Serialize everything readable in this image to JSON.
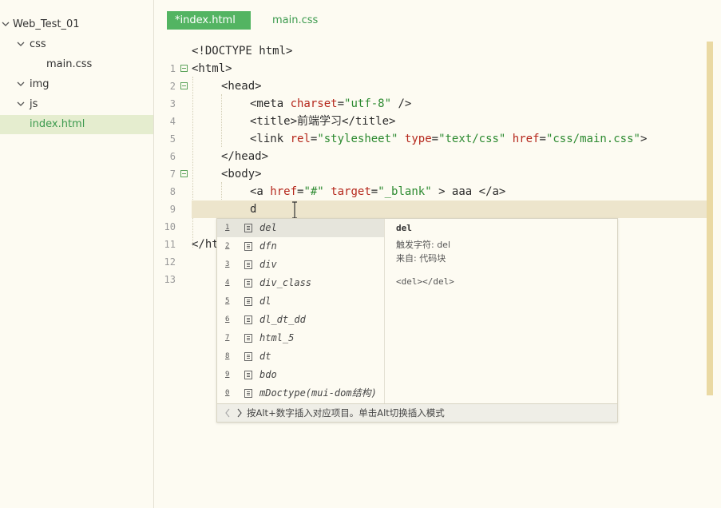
{
  "sidebar": {
    "project": "Web_Test_01",
    "items": [
      {
        "label": "css"
      },
      {
        "label": "main.css"
      },
      {
        "label": "img"
      },
      {
        "label": "js"
      },
      {
        "label": "index.html"
      }
    ]
  },
  "tabs": [
    {
      "label": "*index.html"
    },
    {
      "label": "main.css"
    }
  ],
  "lines": [
    {
      "no": "1"
    },
    {
      "no": "2"
    },
    {
      "no": "3"
    },
    {
      "no": "4"
    },
    {
      "no": "5"
    },
    {
      "no": "6"
    },
    {
      "no": "7"
    },
    {
      "no": "8"
    },
    {
      "no": "9"
    },
    {
      "no": "10"
    },
    {
      "no": "11"
    },
    {
      "no": "12"
    },
    {
      "no": "13"
    }
  ],
  "code": {
    "l1": "<!DOCTYPE html>",
    "l2": "<html>",
    "l3": "<head>",
    "l4a": "<meta ",
    "l4b": "charset",
    "l4c": "=",
    "l4d": "\"utf-8\"",
    "l4e": " />",
    "l5a": "<title>",
    "l5b": "前端学习",
    "l5c": "</title>",
    "l6a": "<link ",
    "l6b": "rel",
    "l6c": "=",
    "l6d": "\"stylesheet\"",
    "l6e": " ",
    "l6f": "type",
    "l6g": "=",
    "l6h": "\"text/css\"",
    "l6i": " ",
    "l6j": "href",
    "l6k": "=",
    "l6l": "\"css/main.css\"",
    "l6m": ">",
    "l7": "</head>",
    "l8": "<body>",
    "l9a": "<a ",
    "l9b": "href",
    "l9c": "=",
    "l9d": "\"#\"",
    "l9e": " ",
    "l9f": "target",
    "l9g": "=",
    "l9h": "\"_blank\"",
    "l9i": " > aaa </a>",
    "l10": "d",
    "l12": "</ht"
  },
  "autocomplete": {
    "items": [
      {
        "num": "1",
        "label": "del"
      },
      {
        "num": "2",
        "label": "dfn"
      },
      {
        "num": "3",
        "label": "div"
      },
      {
        "num": "4",
        "label": "div_class"
      },
      {
        "num": "5",
        "label": "dl"
      },
      {
        "num": "6",
        "label": "dl_dt_dd"
      },
      {
        "num": "7",
        "label": "html_5"
      },
      {
        "num": "8",
        "label": "dt"
      },
      {
        "num": "9",
        "label": "bdo"
      },
      {
        "num": "0",
        "label": "mDoctype(mui-dom结构)"
      }
    ],
    "detail": {
      "title": "del",
      "trigger": "触发字符: del",
      "source": "来自: 代码块",
      "snippet": "<del></del>"
    },
    "footer": "按Alt+数字插入对应项目。单击Alt切换插入模式"
  },
  "colors": {
    "accent": "#53b462",
    "tag": "#2c2c2c",
    "attribute": "#b5271c",
    "string": "#2c8a30",
    "background": "#fdfbf2"
  }
}
